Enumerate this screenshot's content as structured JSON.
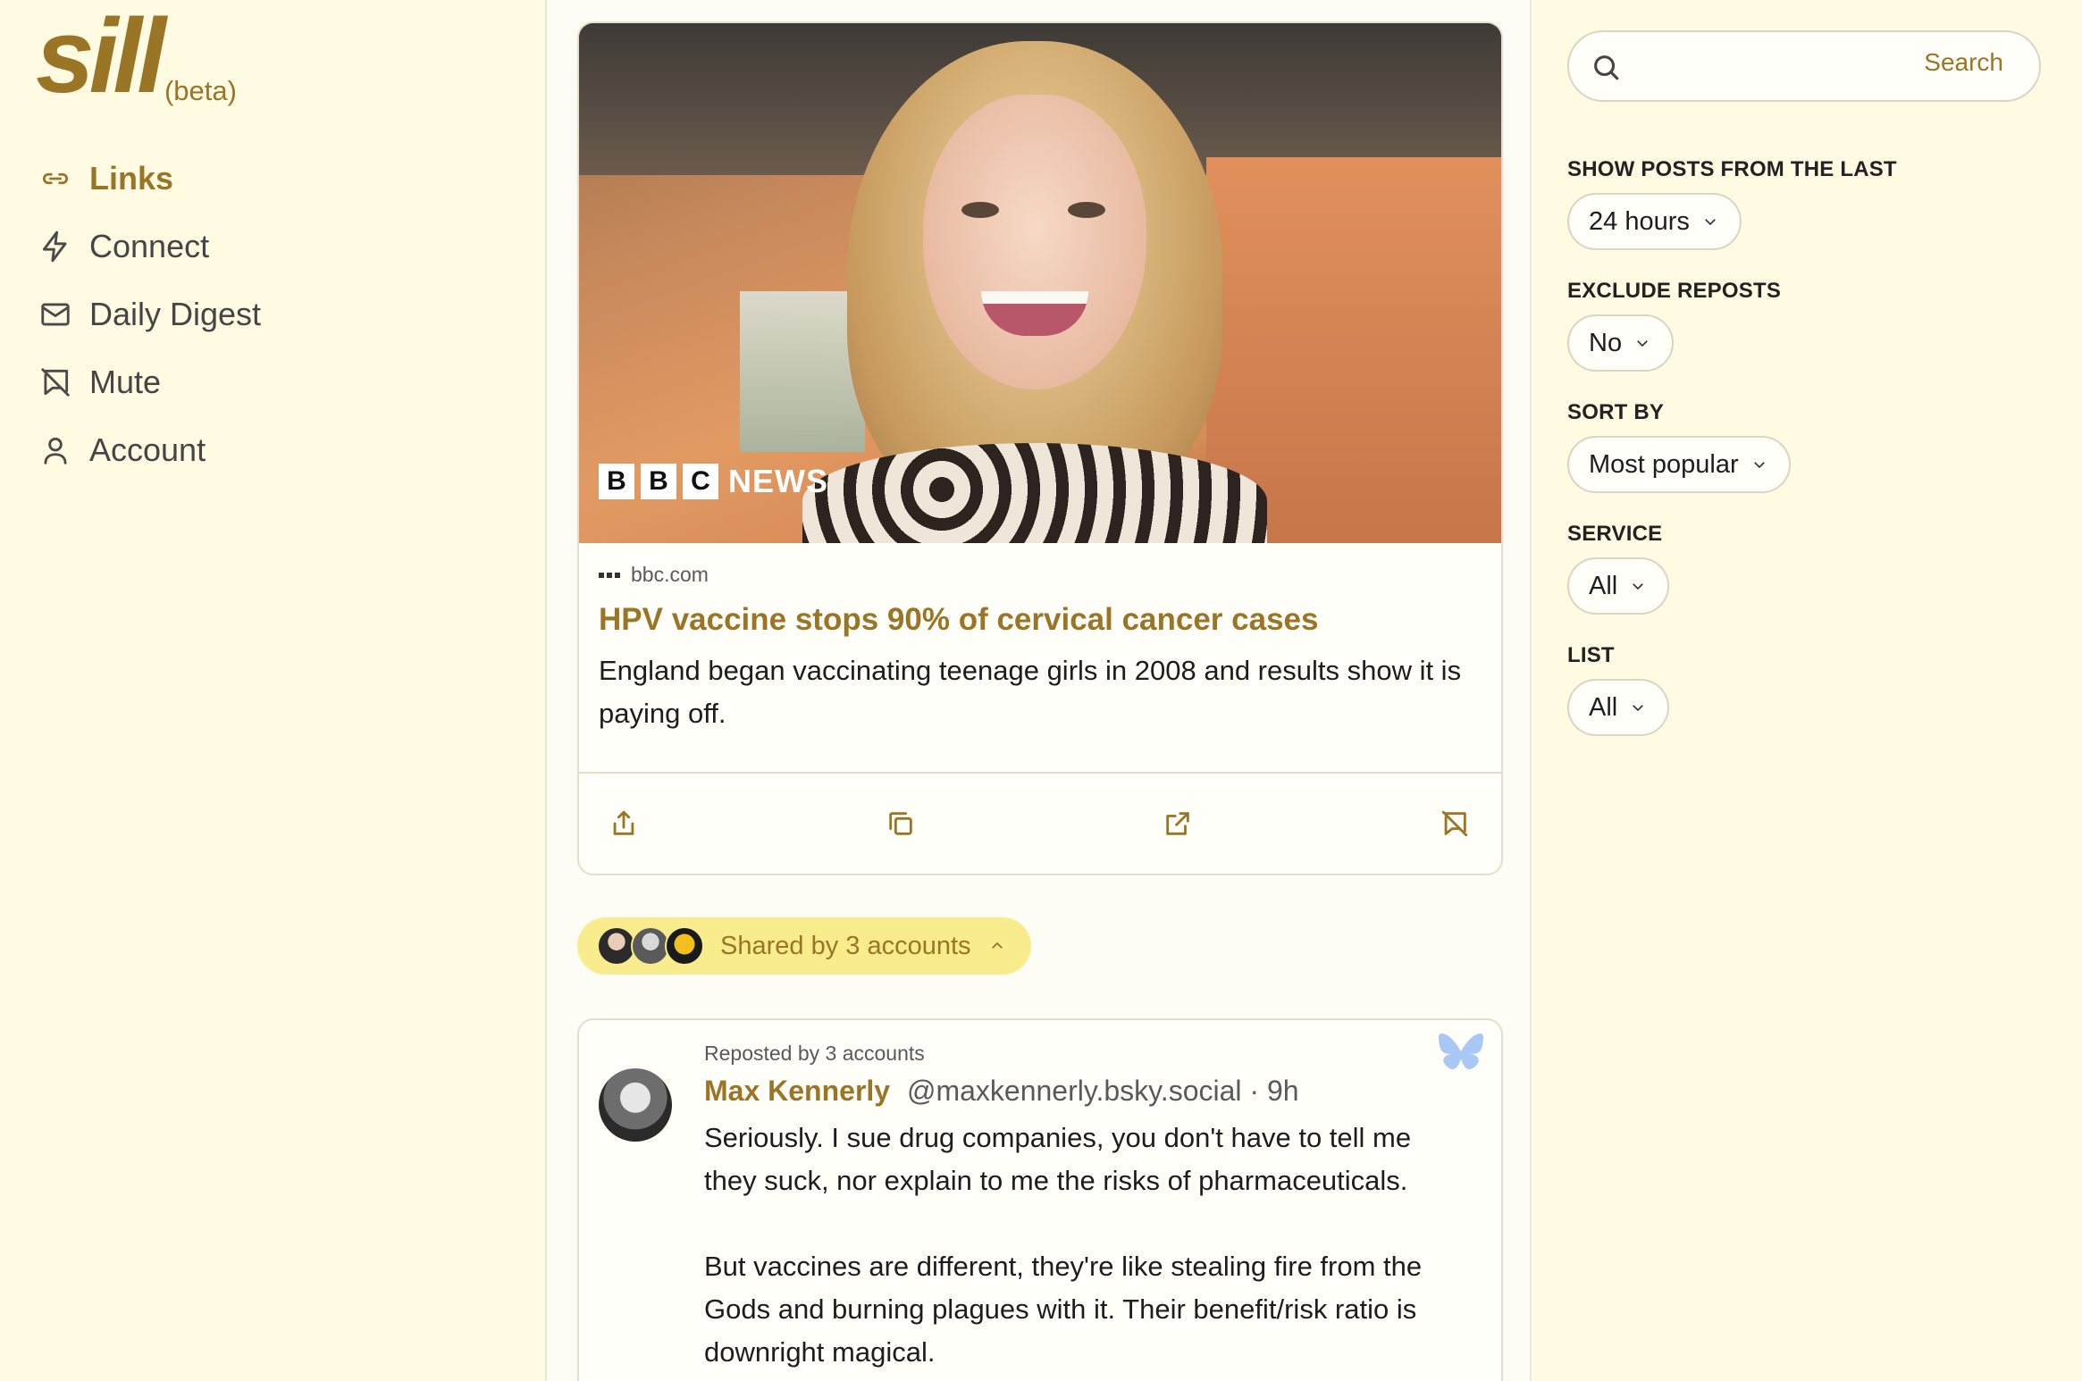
{
  "brand": {
    "name": "sill",
    "tag": "(beta)"
  },
  "nav": [
    {
      "label": "Links",
      "icon": "link-icon",
      "active": true
    },
    {
      "label": "Connect",
      "icon": "lightning-icon",
      "active": false
    },
    {
      "label": "Daily Digest",
      "icon": "mail-icon",
      "active": false
    },
    {
      "label": "Mute",
      "icon": "mute-icon",
      "active": false
    },
    {
      "label": "Account",
      "icon": "user-icon",
      "active": false
    }
  ],
  "link_card": {
    "image_logo": {
      "letters": [
        "B",
        "B",
        "C"
      ],
      "word": "NEWS"
    },
    "domain": "bbc.com",
    "title": "HPV vaccine stops 90% of cervical cancer cases",
    "description": "England began vaccinating teenage girls in 2008 and results show it is paying off.",
    "actions": [
      "share-icon",
      "copy-icon",
      "open-external-icon",
      "mute-icon"
    ]
  },
  "shared": {
    "label": "Shared by 3 accounts"
  },
  "post": {
    "reposted": "Reposted by 3 accounts",
    "author_name": "Max Kennerly",
    "author_meta": "@maxkennerly.bsky.social · 9h",
    "text": "Seriously. I sue drug companies, you don't have to tell me they suck, nor explain to me the risks of pharmaceuticals.\n\nBut vaccines are different, they're like stealing fire from the Gods and burning plagues with it. Their benefit/risk ratio is downright magical.",
    "service_icon": "bluesky-butterfly-icon"
  },
  "search": {
    "placeholder": "",
    "button": "Search"
  },
  "filters": [
    {
      "label": "SHOW POSTS FROM THE LAST",
      "value": "24 hours"
    },
    {
      "label": "EXCLUDE REPOSTS",
      "value": "No"
    },
    {
      "label": "SORT BY",
      "value": "Most popular"
    },
    {
      "label": "SERVICE",
      "value": "All"
    },
    {
      "label": "LIST",
      "value": "All"
    }
  ],
  "colors": {
    "accent": "#9a7526",
    "sidebar_bg": "#fefbe2",
    "pill_bg": "#f8ec8d"
  }
}
